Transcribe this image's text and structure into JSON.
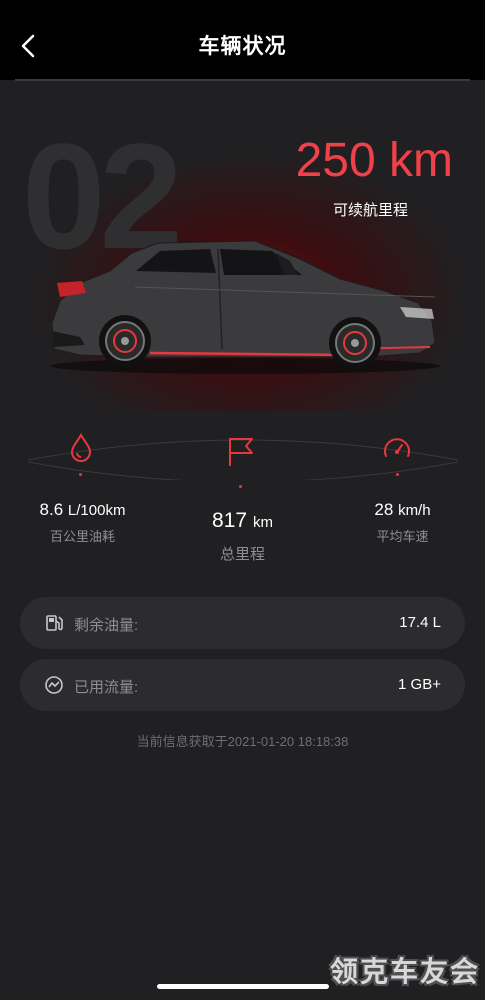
{
  "header": {
    "title": "车辆状况",
    "back_icon": "chevron-left-icon"
  },
  "hero": {
    "model_number": "02",
    "range_value": "250 km",
    "range_label": "可续航里程",
    "accent_color": "#f0404a"
  },
  "stats": {
    "fuel_consumption": {
      "icon": "fuel-drop-icon",
      "value": "8.6",
      "unit": "L/100km",
      "label": "百公里油耗"
    },
    "total_mileage": {
      "icon": "flag-icon",
      "value": "817",
      "unit": "km",
      "label": "总里程"
    },
    "average_speed": {
      "icon": "speedometer-icon",
      "value": "28",
      "unit": "km/h",
      "label": "平均车速"
    }
  },
  "info_rows": [
    {
      "icon": "fuel-pump-icon",
      "label": "剩余油量:",
      "value": "17.4 L"
    },
    {
      "icon": "data-usage-icon",
      "label": "已用流量:",
      "value": "1 GB+"
    }
  ],
  "timestamp": "当前信息获取于2021-01-20 18:18:38",
  "watermark": "领克车友会"
}
